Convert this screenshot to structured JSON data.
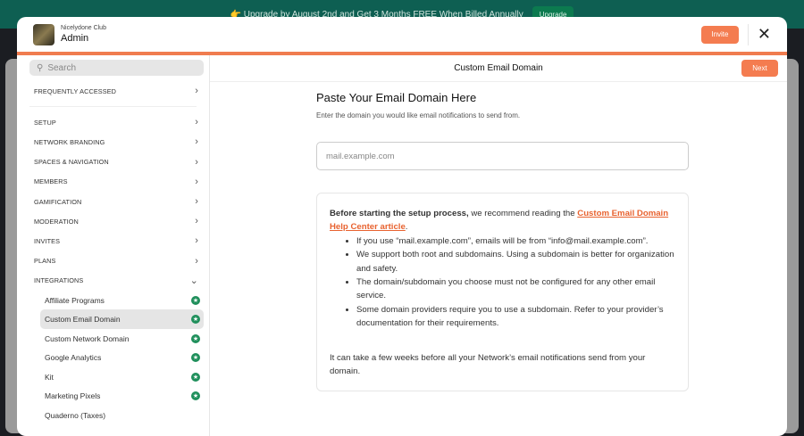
{
  "banner": {
    "text": "👉 Upgrade by August 2nd and Get 3 Months FREE When Billed Annually",
    "button": "Upgrade"
  },
  "header": {
    "club": "Nicelydone Club",
    "title": "Admin",
    "invite": "Invite"
  },
  "sidebar": {
    "search_placeholder": "Search",
    "frequent": "FREQUENTLY ACCESSED",
    "sections": [
      "SETUP",
      "NETWORK BRANDING",
      "SPACES & NAVIGATION",
      "MEMBERS",
      "GAMIFICATION",
      "MODERATION",
      "INVITES",
      "PLANS",
      "INTEGRATIONS"
    ],
    "integrations": [
      {
        "label": "Affiliate Programs",
        "star": true
      },
      {
        "label": "Custom Email Domain",
        "star": true,
        "active": true
      },
      {
        "label": "Custom Network Domain",
        "star": true
      },
      {
        "label": "Google Analytics",
        "star": true
      },
      {
        "label": "Kit",
        "star": true
      },
      {
        "label": "Marketing Pixels",
        "star": true
      },
      {
        "label": "Quaderno (Taxes)",
        "star": false
      }
    ]
  },
  "main": {
    "title": "Custom Email Domain",
    "next": "Next",
    "heading": "Paste Your Email Domain Here",
    "description": "Enter the domain you would like email notifications to send from.",
    "input_placeholder": "mail.example.com",
    "info": {
      "lead_bold": "Before starting the setup process,",
      "lead": " we recommend reading the ",
      "link": "Custom Email Domain Help Center article",
      "period": ".",
      "bullets": [
        "If you use “mail.example.com”, emails will be from “info@mail.example.com”.",
        "We support both root and subdomains. Using a subdomain is better for organization and safety.",
        "The domain/subdomain you choose must not be configured for any other email service.",
        "Some domain providers require you to use a subdomain. Refer to your provider’s documentation for their requirements."
      ],
      "footer": "It can take a few weeks before all your Network’s email notifications send from your domain."
    }
  }
}
